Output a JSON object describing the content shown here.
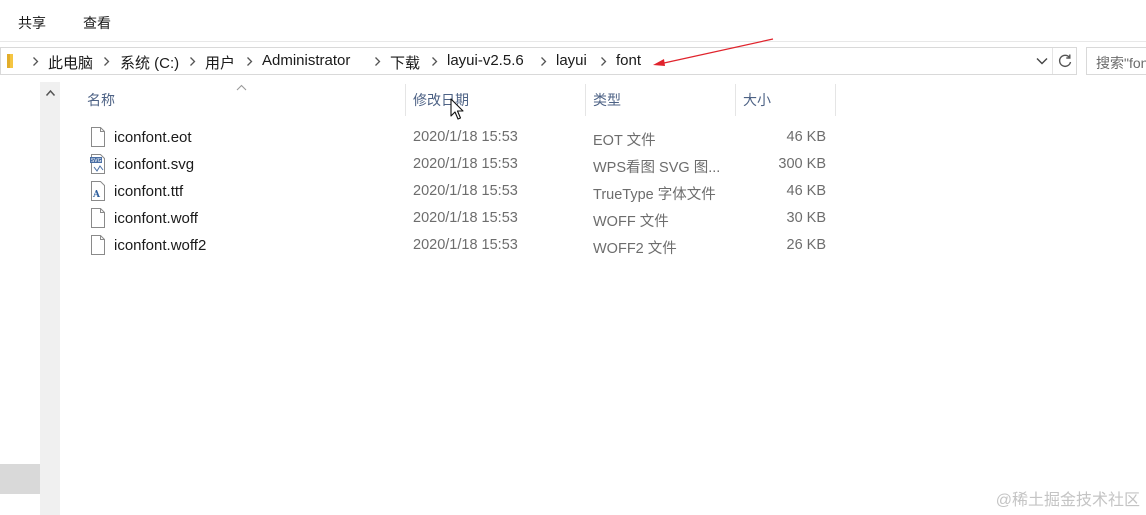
{
  "ribbon": {
    "tabs": [
      {
        "label": "共享"
      },
      {
        "label": "查看"
      }
    ]
  },
  "address_bar": {
    "breadcrumbs": [
      "此电脑",
      "系统 (C:)",
      "用户",
      "Administrator",
      "下载",
      "layui-v2.5.6",
      "layui",
      "font"
    ]
  },
  "search": {
    "text": "搜索\"font\""
  },
  "columns": {
    "name": "名称",
    "date": "修改日期",
    "type": "类型",
    "size": "大小"
  },
  "files": [
    {
      "name": "iconfont.eot",
      "date": "2020/1/18 15:53",
      "type": "EOT 文件",
      "size": "46 KB",
      "icon": "blank-file-icon"
    },
    {
      "name": "iconfont.svg",
      "date": "2020/1/18 15:53",
      "type": "WPS看图 SVG 图...",
      "size": "300 KB",
      "icon": "svg-image-file-icon"
    },
    {
      "name": "iconfont.ttf",
      "date": "2020/1/18 15:53",
      "type": "TrueType 字体文件",
      "size": "46 KB",
      "icon": "truetype-font-file-icon"
    },
    {
      "name": "iconfont.woff",
      "date": "2020/1/18 15:53",
      "type": "WOFF 文件",
      "size": "30 KB",
      "icon": "blank-file-icon"
    },
    {
      "name": "iconfont.woff2",
      "date": "2020/1/18 15:53",
      "type": "WOFF2 文件",
      "size": "26 KB",
      "icon": "blank-file-icon"
    }
  ],
  "watermark": "@稀土掘金技术社区",
  "colors": {
    "column_header": "#4d6285",
    "secondary_text": "#6d6d6d",
    "annotation_arrow": "#e0232c",
    "folder": "#f5c542"
  }
}
